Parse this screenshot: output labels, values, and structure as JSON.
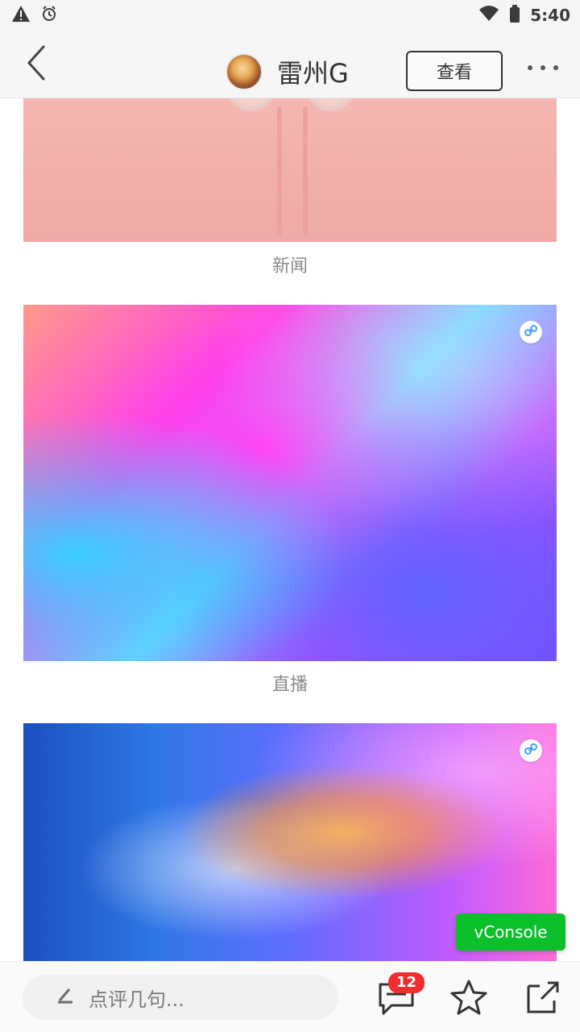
{
  "status_bar": {
    "time": "5:40"
  },
  "header": {
    "title": "雷州G",
    "view_button": "查看"
  },
  "content": {
    "items": [
      {
        "caption": "新闻"
      },
      {
        "caption": "直播"
      },
      {
        "caption": ""
      }
    ]
  },
  "debug": {
    "vconsole_label": "vConsole"
  },
  "bottom_bar": {
    "comment_placeholder": "点评几句...",
    "comment_count": "12"
  },
  "colors": {
    "accent_red": "#ef2e2e",
    "vconsole_green": "#0bc02a",
    "text_primary": "#333333",
    "text_muted": "#8a8a8a"
  },
  "icons": {
    "status_left": [
      "warning-icon",
      "alarm-icon"
    ],
    "status_right": [
      "wifi-icon",
      "battery-icon"
    ],
    "header": [
      "back-arrow-icon",
      "more-icon"
    ],
    "bottom": [
      "pen-icon",
      "comment-icon",
      "star-icon",
      "share-icon"
    ],
    "image": [
      "link-icon"
    ]
  }
}
